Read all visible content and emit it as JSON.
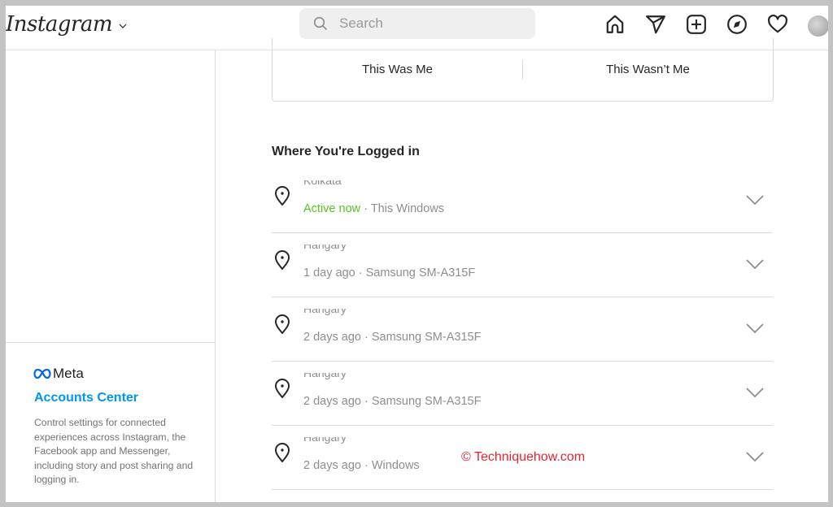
{
  "header": {
    "logo": "Instagram",
    "search_placeholder": "Search",
    "nav_icons": [
      "home-icon",
      "direct-message-icon",
      "new-post-icon",
      "explore-icon",
      "activity-heart-icon",
      "profile-avatar"
    ]
  },
  "login_activity_card": {
    "confirm_label": "This Was Me",
    "deny_label": "This Wasn’t Me"
  },
  "sessions_section": {
    "title": "Where You're Logged in",
    "sessions": [
      {
        "location": "Kolkata",
        "time": "Active now",
        "device": "This Windows",
        "active": true
      },
      {
        "location": "Hangary",
        "time": "1 day ago",
        "device": "Samsung SM-A315F",
        "active": false
      },
      {
        "location": "Hangary",
        "time": "2 days ago",
        "device": "Samsung SM-A315F",
        "active": false
      },
      {
        "location": "Hangary",
        "time": "2 days ago",
        "device": "Samsung SM-A315F",
        "active": false
      },
      {
        "location": "Hangary",
        "time": "2 days ago",
        "device": "Windows",
        "active": false
      }
    ]
  },
  "sidebar": {
    "meta_brand": "Meta",
    "accounts_center_label": "Accounts Center",
    "accounts_center_description": "Control settings for connected experiences across Instagram, the Facebook app and Messenger, including story and post sharing and logging in."
  },
  "watermark": "© Techniquehow.com",
  "colors": {
    "active_status": "#58c322",
    "link_blue": "#0095f6",
    "watermark_red": "#e4262d"
  }
}
